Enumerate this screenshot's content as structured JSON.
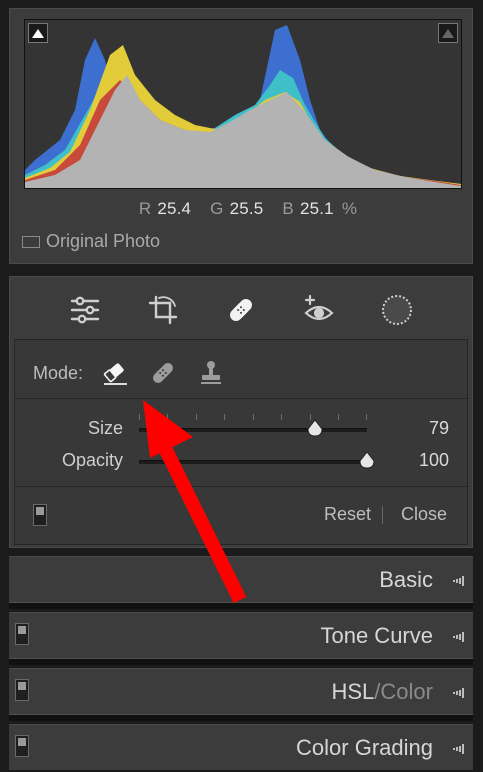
{
  "histogram": {
    "readout": {
      "r_label": "R",
      "r_value": "25.4",
      "g_label": "G",
      "g_value": "25.5",
      "b_label": "B",
      "b_value": "25.1",
      "unit": "%"
    },
    "original_photo_label": "Original Photo"
  },
  "tools": {
    "strip": [
      "sliders-icon",
      "crop-icon",
      "healing-bandage-icon",
      "red-eye-icon",
      "masking-circle-icon"
    ],
    "mode_label": "Mode:",
    "size_label": "Size",
    "size_value": "79",
    "size_fraction": 0.77,
    "opacity_label": "Opacity",
    "opacity_value": "100",
    "opacity_fraction": 1.0,
    "reset_label": "Reset",
    "close_label": "Close"
  },
  "sections": {
    "basic": "Basic",
    "tone_curve": "Tone Curve",
    "hsl": "HSL",
    "hsl_sep": "/",
    "color": "Color",
    "color_grading": "Color Grading"
  },
  "colors": {
    "panel_bg": "#3c3c3c",
    "annotation_arrow": "#ff0000"
  }
}
